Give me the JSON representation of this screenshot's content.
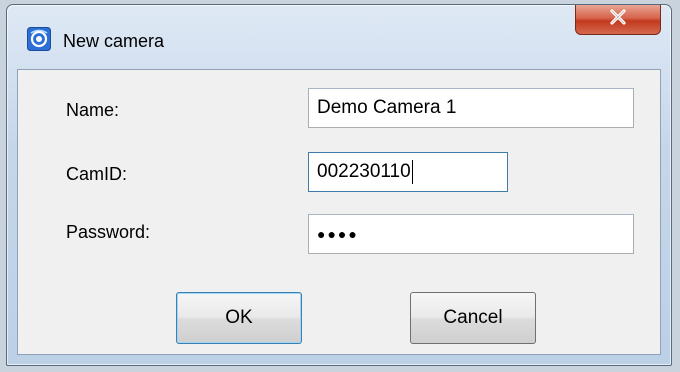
{
  "window": {
    "title": "New camera",
    "icon": "camera-app-icon",
    "close_icon": "close-x-icon"
  },
  "form": {
    "name_label": "Name:",
    "name_value": "Demo Camera 1",
    "camid_label": "CamID:",
    "camid_value": "002230110",
    "password_label": "Password:",
    "password_masked": "●●●●"
  },
  "buttons": {
    "ok_label": "OK",
    "cancel_label": "Cancel"
  },
  "colors": {
    "close_button": "#c2391f",
    "focus_border": "#3d7bad",
    "dialog_background": "#f0f0f0"
  }
}
